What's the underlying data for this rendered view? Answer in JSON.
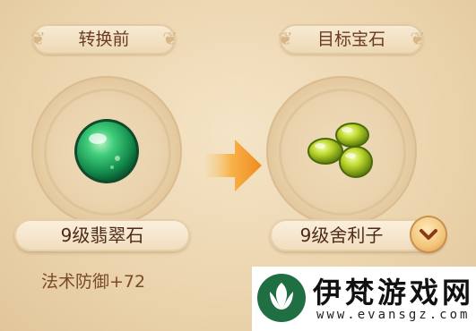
{
  "left": {
    "header": "转换前",
    "gem_name": "9级翡翠石",
    "stat": "法术防御+72"
  },
  "right": {
    "header": "目标宝石",
    "gem_name": "9级舍利子"
  },
  "icons": {
    "source_gem": "green-orb-gem-icon",
    "target_gem": "yellow-green-gems-icon",
    "arrow": "arrow-right-icon",
    "dropdown": "chevron-down-icon"
  },
  "watermark": {
    "title": "伊梵游戏网",
    "url": "www.evansgz.com"
  },
  "colors": {
    "panel_bg": "#ebd4ad",
    "text_brown": "#4e2a18",
    "arrow_orange": "#f2a23a",
    "gem_green": "#2fb56a",
    "gem_yellow": "#b9d530"
  }
}
